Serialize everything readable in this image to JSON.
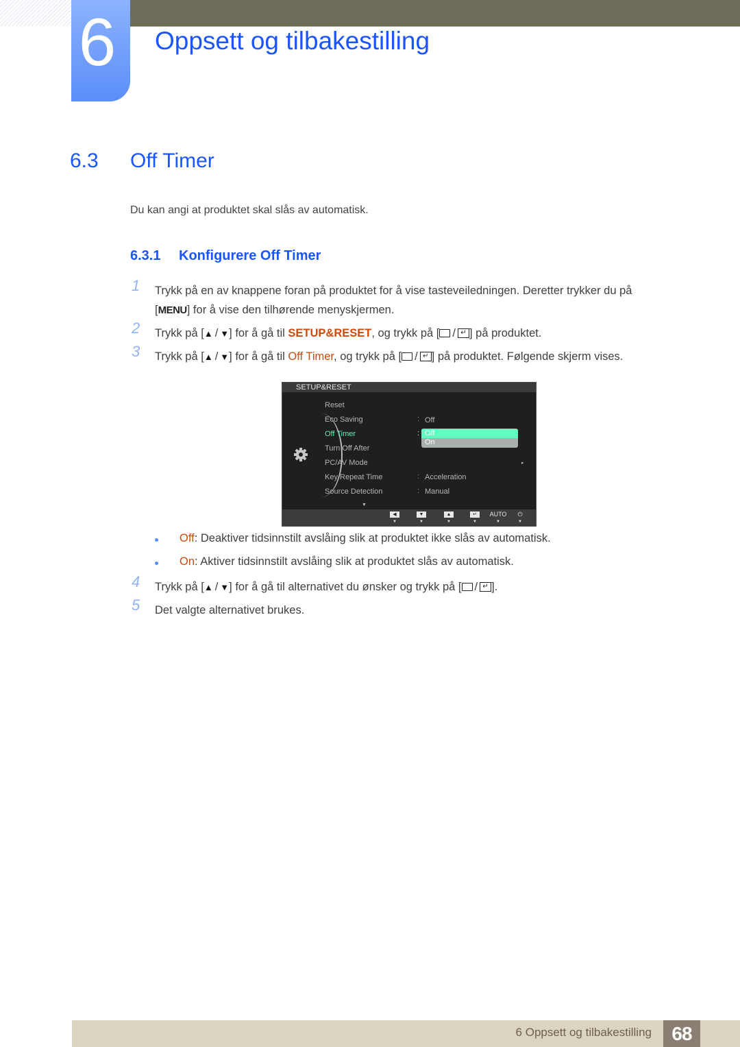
{
  "chapter": {
    "number": "6",
    "title": "Oppsett og tilbakestilling"
  },
  "section": {
    "number": "6.3",
    "title": "Off Timer",
    "intro": "Du kan angi at produktet skal slås av automatisk."
  },
  "subsection": {
    "number": "6.3.1",
    "title": "Konfigurere Off Timer"
  },
  "steps": [
    {
      "num": "1",
      "line1": "Trykk på en av knappene foran på produktet for å vise tasteveiledningen. Deretter trykker du på",
      "line2_key": "MENU",
      "line2_rest": "] for å vise den tilhørende menyskjermen."
    },
    {
      "num": "2",
      "pre": "Trykk på [",
      "mid1": "] for å gå til ",
      "highlight": "SETUP&RESET",
      "mid2": ", og trykk på [",
      "post": "] på produktet."
    },
    {
      "num": "3",
      "pre": "Trykk på [",
      "mid1": "] for å gå til ",
      "highlight": "Off Timer",
      "mid2": ", og trykk på [",
      "post": "] på produktet. Følgende skjerm vises."
    },
    {
      "num": "4",
      "pre": "Trykk på [",
      "mid1": "] for å gå til alternativet du ønsker og trykk på [",
      "post": "]."
    },
    {
      "num": "5",
      "text": "Det valgte alternativet brukes."
    }
  ],
  "osd": {
    "header": "SETUP&RESET",
    "items": [
      {
        "label": "Reset",
        "value": ""
      },
      {
        "label": "Eco Saving",
        "value": "Off"
      },
      {
        "label": "Off Timer",
        "value": ""
      },
      {
        "label": "Turn Off After",
        "value": ""
      },
      {
        "label": "PC/AV Mode",
        "value": ""
      },
      {
        "label": "Key Repeat Time",
        "value": "Acceleration"
      },
      {
        "label": "Source Detection",
        "value": "Manual"
      }
    ],
    "colon": ":",
    "dropdown": {
      "selected": "Off",
      "other": "On"
    },
    "footer_buttons": {
      "left": "◀",
      "down": "▼",
      "up": "▲",
      "enter": "↵",
      "auto": "AUTO",
      "power": "⏻",
      "marker": "▼"
    },
    "right_arrow": "▸",
    "scroll_down": "▼",
    "active_color": "#5ef0b0"
  },
  "bullets": [
    {
      "term": "Off",
      "text": ": Deaktiver tidsinnstilt avslåing slik at produktet ikke slås av automatisk."
    },
    {
      "term": "On",
      "text": ": Aktiver tidsinnstilt avslåing slik at produktet slås av automatisk."
    }
  ],
  "symbols": {
    "bracket_open": "[",
    "up": "▲",
    "slash": "/",
    "down": "▼",
    "enter_glyph": "↵"
  },
  "footer": {
    "text": "6 Oppsett og tilbakestilling",
    "page": "68"
  },
  "colors": {
    "heading_blue": "#1a55ff",
    "highlight_orange": "#cc4b0c",
    "top_bar": "#6e6c58",
    "footer_bar": "#dbd4c0",
    "footer_page": "#8a7f72"
  }
}
